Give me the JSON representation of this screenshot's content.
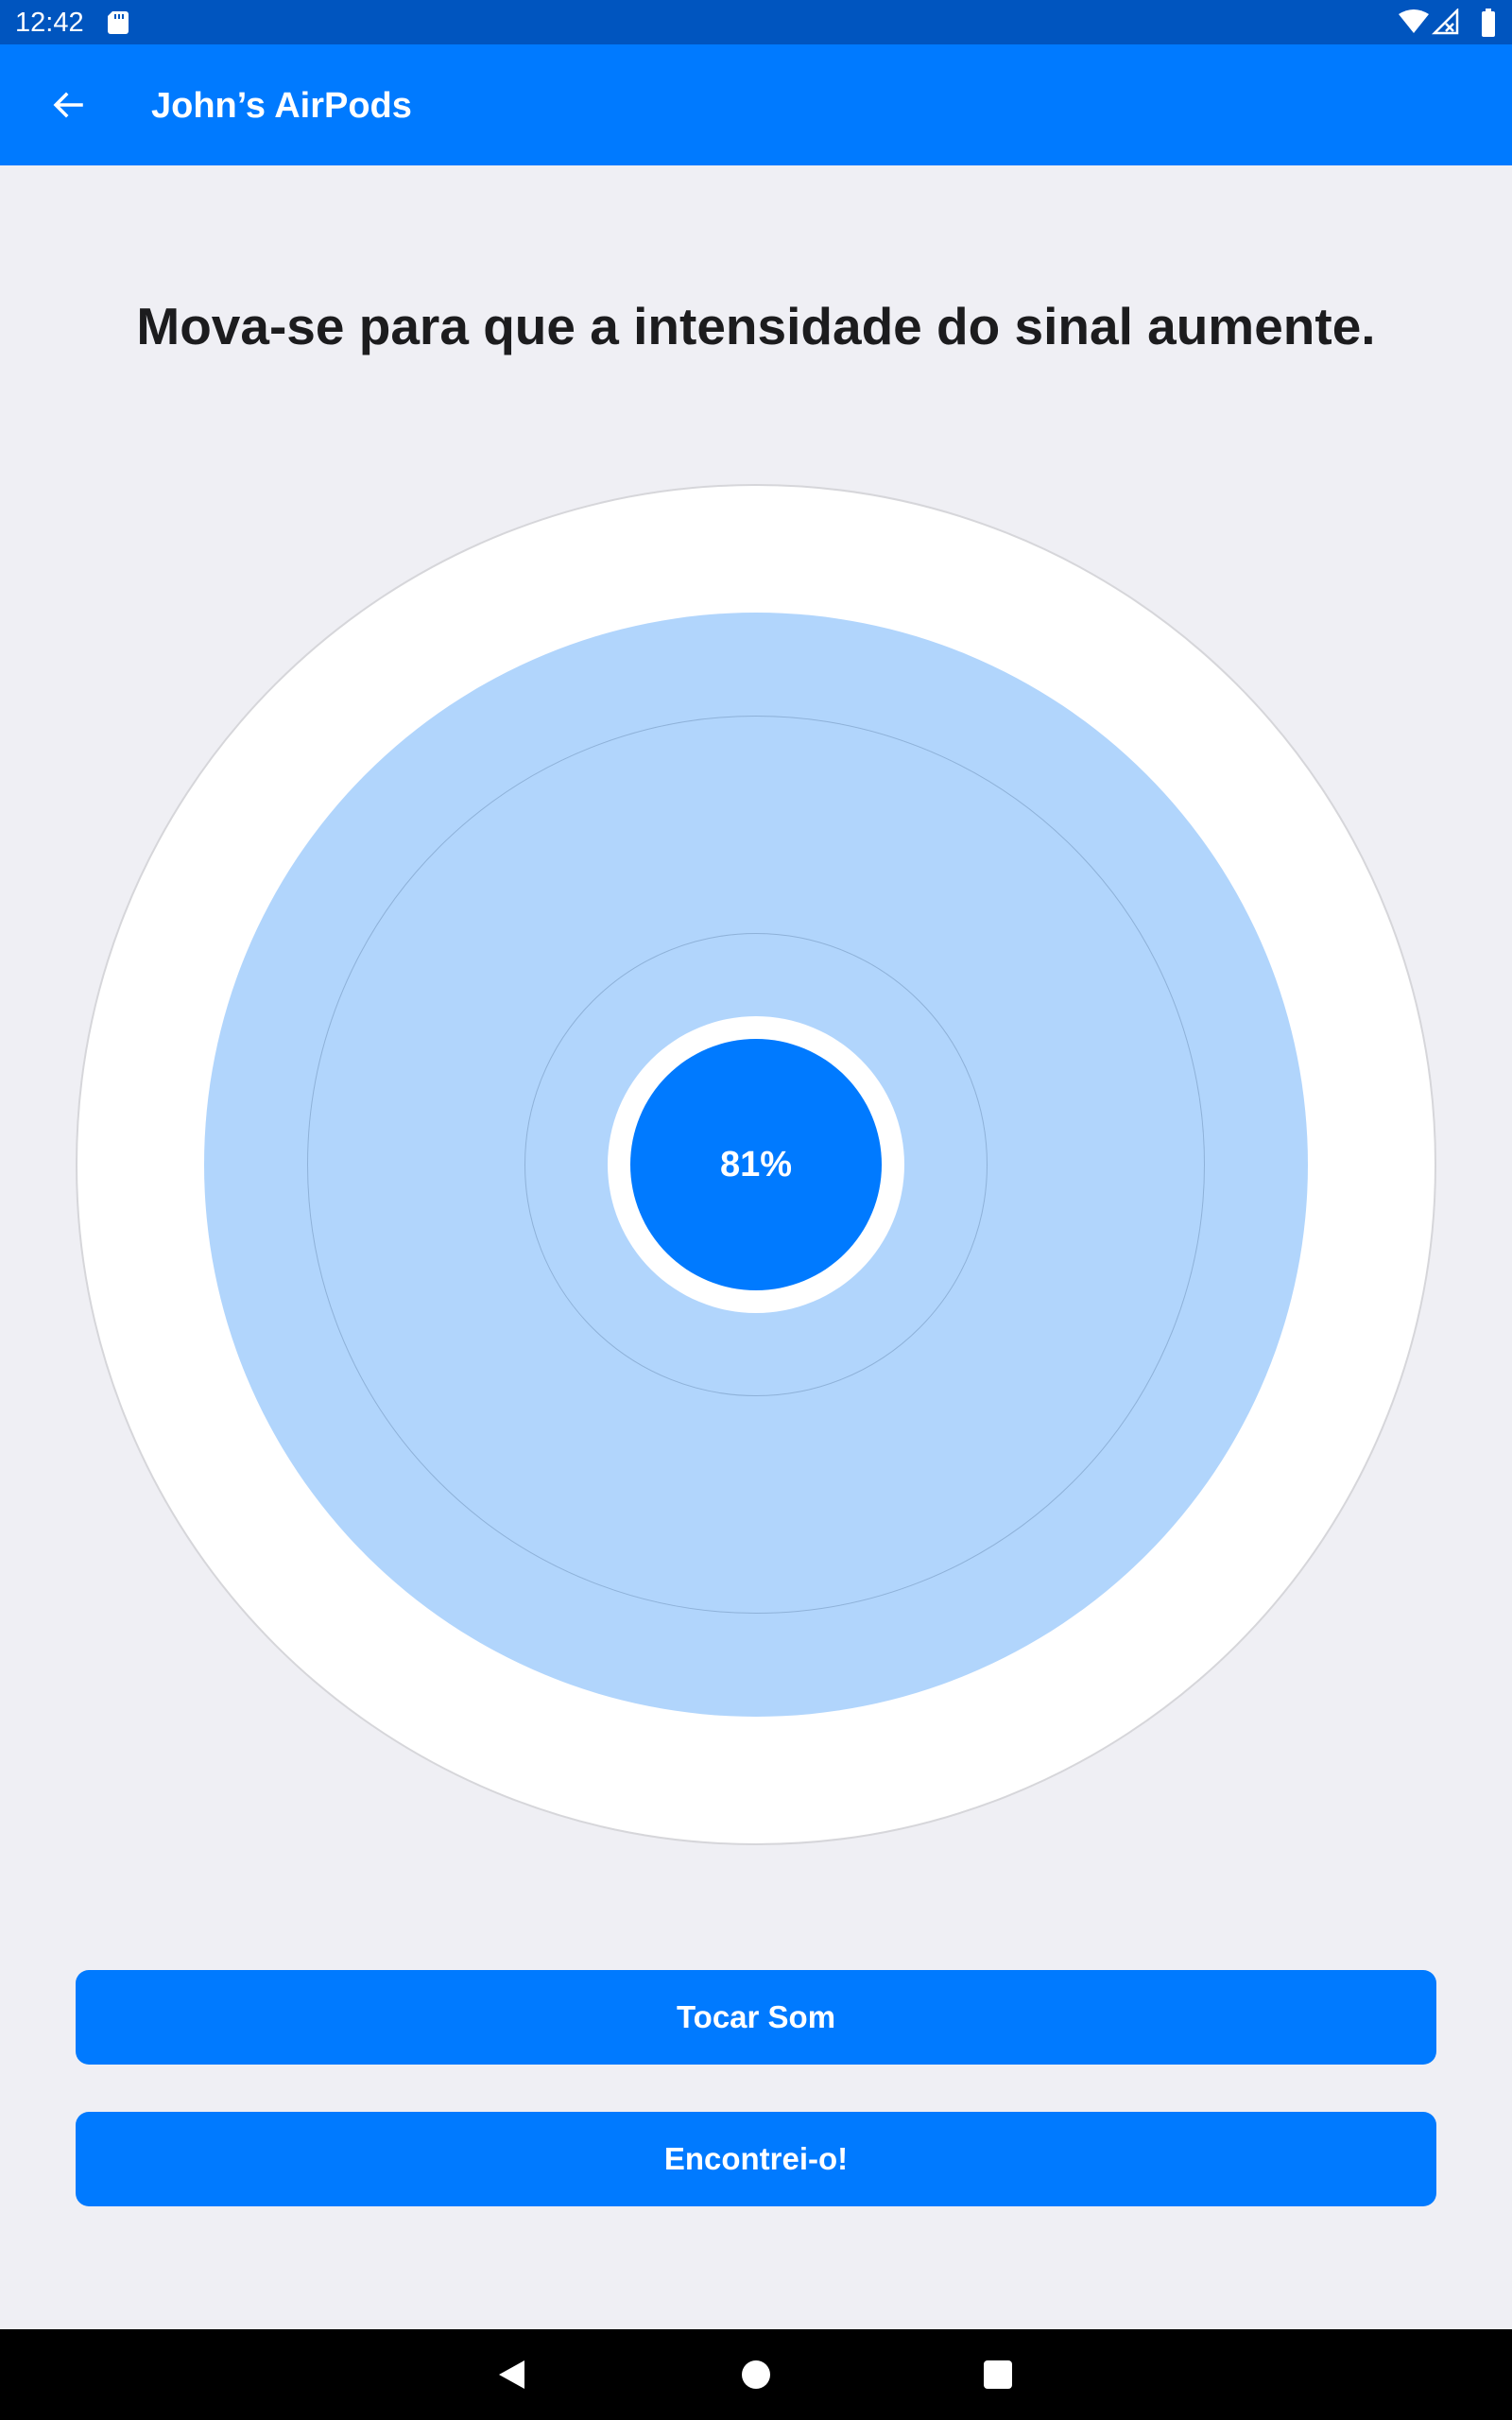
{
  "status_bar": {
    "time": "12:42",
    "icons": [
      "sd-card-icon",
      "wifi-icon",
      "cell-signal-icon",
      "battery-icon"
    ]
  },
  "app_bar": {
    "title": "John’s AirPods",
    "back_icon": "arrow-left-icon"
  },
  "instruction": "Mova-se para que a intensidade do sinal aumente.",
  "signal": {
    "percent_label": "81%",
    "strength": 0.81
  },
  "buttons": {
    "play_sound": "Tocar Som",
    "found_it": "Encontrei-o!"
  },
  "nav_bar": {
    "icons": [
      "back-triangle-icon",
      "home-circle-icon",
      "recents-square-icon"
    ]
  },
  "colors": {
    "status_bar": "#0055bf",
    "app_bar": "#007aff",
    "accent": "#007aff",
    "signal_fill": "#b1d5fc",
    "background": "#efeff4",
    "nav_bar": "#000000"
  }
}
